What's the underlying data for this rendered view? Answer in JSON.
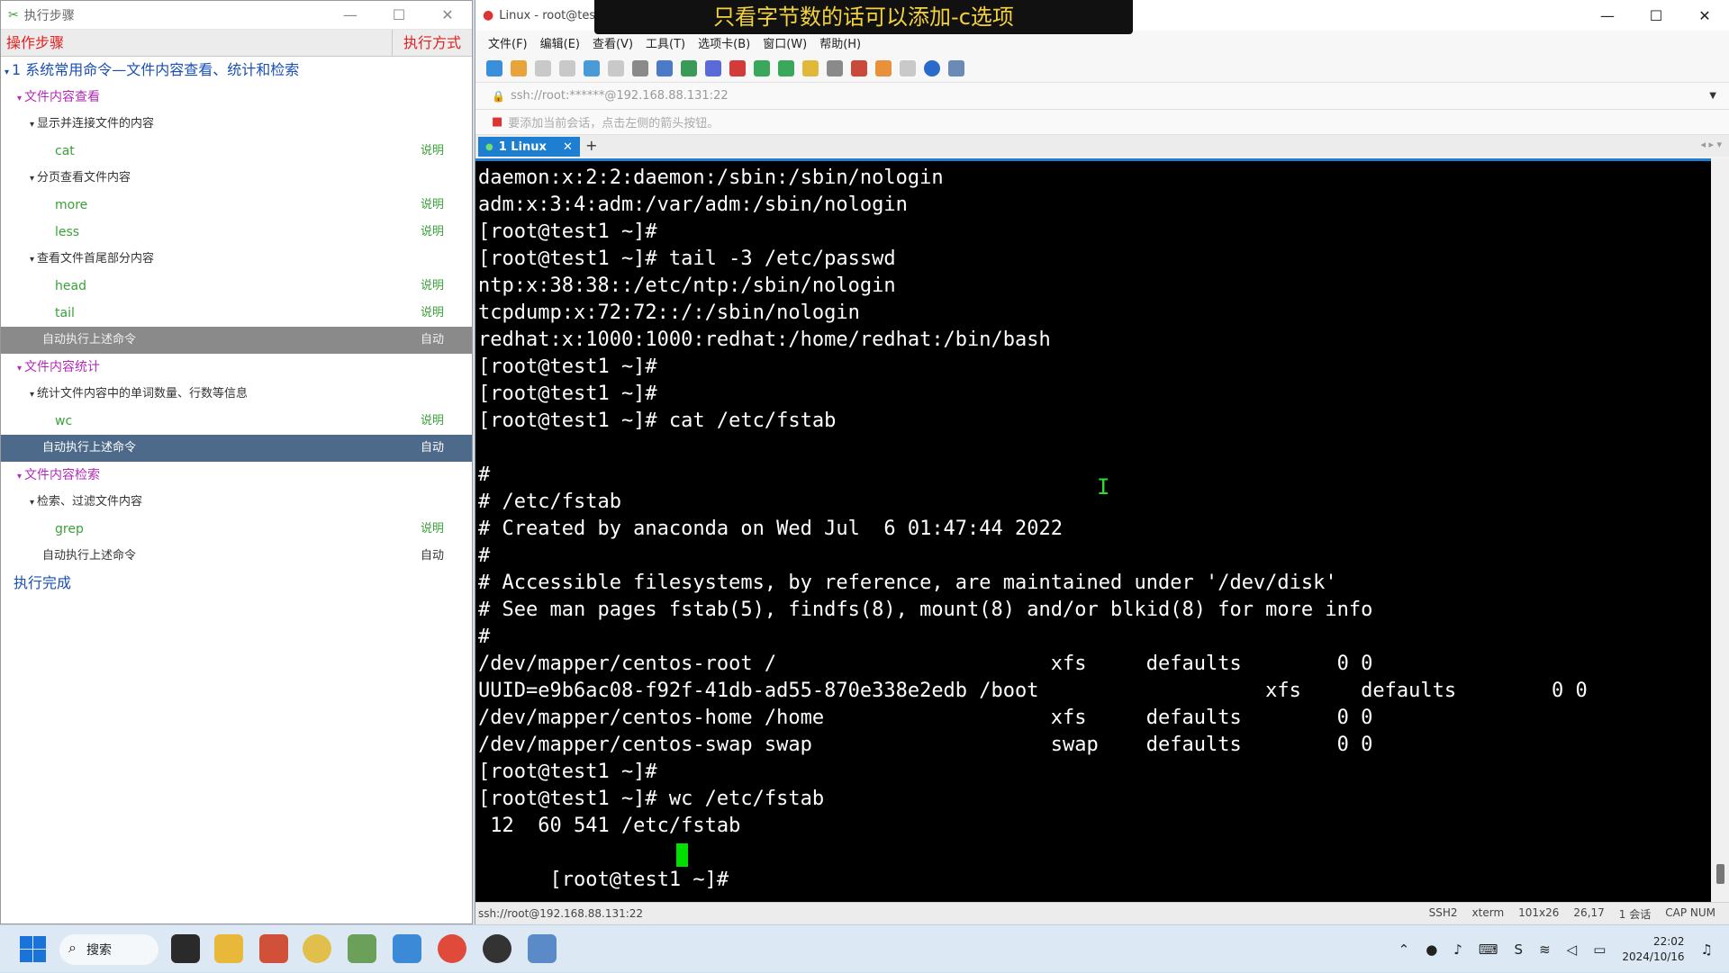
{
  "left_panel": {
    "title": "执行步骤",
    "header_col1": "操作步骤",
    "header_col2": "执行方式",
    "rows": [
      {
        "text": "1 系统常用命令—文件内容查看、统计和检索",
        "action": ""
      },
      {
        "text": "文件内容查看",
        "action": ""
      },
      {
        "text": "显示并连接文件的内容",
        "action": ""
      },
      {
        "text": "cat",
        "action": "说明"
      },
      {
        "text": "分页查看文件内容",
        "action": ""
      },
      {
        "text": "more",
        "action": "说明"
      },
      {
        "text": "less",
        "action": "说明"
      },
      {
        "text": "查看文件首尾部分内容",
        "action": ""
      },
      {
        "text": "head",
        "action": "说明"
      },
      {
        "text": "tail",
        "action": "说明"
      },
      {
        "text": "自动执行上述命令",
        "action": "自动"
      },
      {
        "text": "文件内容统计",
        "action": ""
      },
      {
        "text": "统计文件内容中的单词数量、行数等信息",
        "action": ""
      },
      {
        "text": "wc",
        "action": "说明"
      },
      {
        "text": "自动执行上述命令",
        "action": "自动"
      },
      {
        "text": "文件内容检索",
        "action": ""
      },
      {
        "text": "检索、过滤文件内容",
        "action": ""
      },
      {
        "text": "grep",
        "action": "说明"
      },
      {
        "text": "自动执行上述命令",
        "action": "自动"
      },
      {
        "text": "执行完成",
        "action": ""
      }
    ]
  },
  "xshell": {
    "title": "Linux - root@test",
    "subtitle": "只看字节数的话可以添加-c选项",
    "menu": [
      "文件(F)",
      "编辑(E)",
      "查看(V)",
      "工具(T)",
      "选项卡(B)",
      "窗口(W)",
      "帮助(H)"
    ],
    "address": "ssh://root:******@192.168.88.131:22",
    "hint": "要添加当前会话，点击左侧的箭头按钮。",
    "tab_label": "1 Linux",
    "terminal_lines": [
      "daemon:x:2:2:daemon:/sbin:/sbin/nologin",
      "adm:x:3:4:adm:/var/adm:/sbin/nologin",
      "[root@test1 ~]#",
      "[root@test1 ~]# tail -3 /etc/passwd",
      "ntp:x:38:38::/etc/ntp:/sbin/nologin",
      "tcpdump:x:72:72::/:/sbin/nologin",
      "redhat:x:1000:1000:redhat:/home/redhat:/bin/bash",
      "[root@test1 ~]#",
      "[root@test1 ~]#",
      "[root@test1 ~]# cat /etc/fstab",
      "",
      "#",
      "# /etc/fstab",
      "# Created by anaconda on Wed Jul  6 01:47:44 2022",
      "#",
      "# Accessible filesystems, by reference, are maintained under '/dev/disk'",
      "# See man pages fstab(5), findfs(8), mount(8) and/or blkid(8) for more info",
      "#",
      "/dev/mapper/centos-root /                       xfs     defaults        0 0",
      "UUID=e9b6ac08-f92f-41db-ad55-870e338e2edb /boot                   xfs     defaults        0 0",
      "/dev/mapper/centos-home /home                   xfs     defaults        0 0",
      "/dev/mapper/centos-swap swap                    swap    defaults        0 0",
      "[root@test1 ~]#",
      "[root@test1 ~]# wc /etc/fstab",
      " 12  60 541 /etc/fstab",
      "[root@test1 ~]# "
    ],
    "status": {
      "left": "ssh://root@192.168.88.131:22",
      "protocol": "SSH2",
      "term": "xterm",
      "size": "101x26",
      "pos": "26,17",
      "sessions": "1 会话",
      "caps": "CAP NUM"
    }
  },
  "taskbar": {
    "search_label": "搜索",
    "time": "22:02",
    "date": "2024/10/16"
  }
}
